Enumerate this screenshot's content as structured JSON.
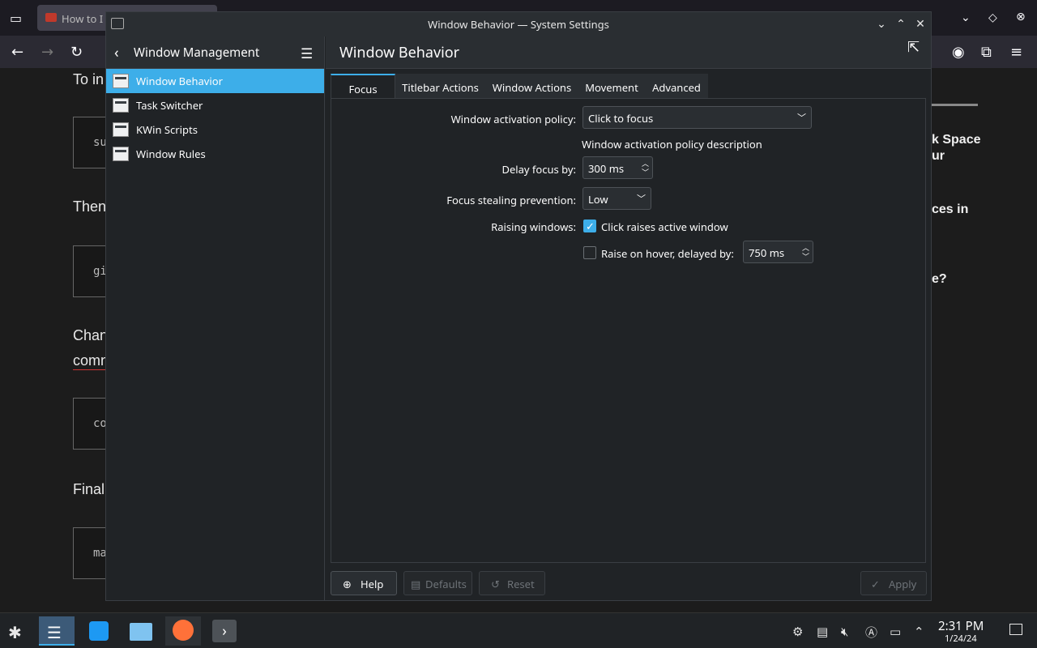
{
  "browser": {
    "tab_title": "How to I",
    "article": {
      "line1": "To in",
      "line2": "Then",
      "line3": "Chan",
      "line3b": "comn",
      "line4": "Final",
      "code1": "su",
      "code2": "gi",
      "code3": "co",
      "code4": "ma"
    },
    "side": {
      "s1": "k Space",
      "s1b": "ur",
      "s2": "ces in",
      "s3": "e?"
    }
  },
  "window": {
    "title": "Window Behavior — System Settings",
    "sidebar": {
      "title": "Window Management",
      "items": [
        {
          "label": "Window Behavior"
        },
        {
          "label": "Task Switcher"
        },
        {
          "label": "KWin Scripts"
        },
        {
          "label": "Window Rules"
        }
      ]
    },
    "main_title": "Window Behavior",
    "tabs": [
      {
        "label": "Focus"
      },
      {
        "label": "Titlebar Actions"
      },
      {
        "label": "Window Actions"
      },
      {
        "label": "Movement"
      },
      {
        "label": "Advanced"
      }
    ],
    "form": {
      "activation_label": "Window activation policy:",
      "activation_value": "Click to focus",
      "activation_desc": "Window activation policy description",
      "delay_label": "Delay focus by:",
      "delay_value": "300 ms",
      "stealing_label": "Focus stealing prevention:",
      "stealing_value": "Low",
      "raising_label": "Raising windows:",
      "click_raises_label": "Click raises active window",
      "click_raises_checked": true,
      "raise_hover_label": "Raise on hover, delayed by:",
      "raise_hover_checked": false,
      "raise_hover_value": "750 ms"
    },
    "footer": {
      "help": "Help",
      "defaults": "Defaults",
      "reset": "Reset",
      "apply": "Apply"
    }
  },
  "taskbar": {
    "time": "2:31 PM",
    "date": "1/24/24"
  },
  "colors": {
    "accent": "#3daee9",
    "window_bg": "#202326",
    "header_bg": "#2a2e32"
  }
}
